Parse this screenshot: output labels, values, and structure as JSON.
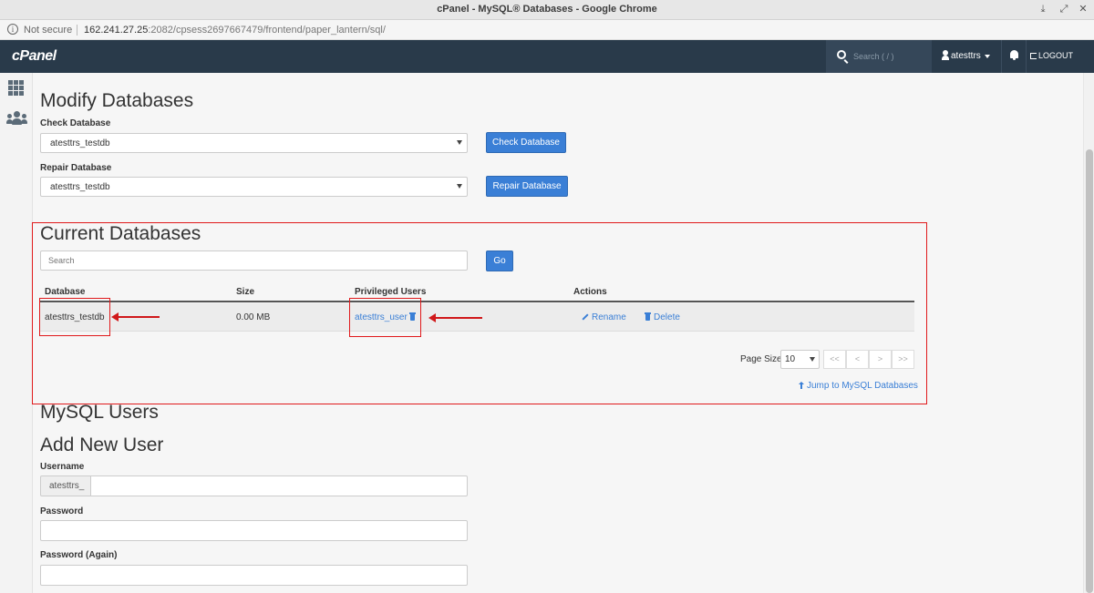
{
  "window": {
    "title": "cPanel - MySQL® Databases - Google Chrome",
    "btn_min": "⤓",
    "btn_max": "⤢",
    "btn_close": "✕"
  },
  "urlbar": {
    "security": "Not secure",
    "info_glyph": "i",
    "url_host": "162.241.27.25",
    "url_rest": ":2082/cpsess2697667479/frontend/paper_lantern/sql/"
  },
  "topnav": {
    "logo": "cPanel",
    "search_placeholder": "Search ( / )",
    "username": "atesttrs",
    "logout": "LOGOUT"
  },
  "modify": {
    "heading": "Modify Databases",
    "check_label": "Check Database",
    "check_value": "atesttrs_testdb",
    "check_button": "Check Database",
    "repair_label": "Repair Database",
    "repair_value": "atesttrs_testdb",
    "repair_button": "Repair Database"
  },
  "current": {
    "heading": "Current Databases",
    "search_placeholder": "Search",
    "go_button": "Go",
    "columns": [
      "Database",
      "Size",
      "Privileged Users",
      "Actions"
    ],
    "rows": [
      {
        "database": "atesttrs_testdb",
        "size": "0.00 MB",
        "user": "atesttrs_user",
        "rename": "Rename",
        "delete": "Delete"
      }
    ],
    "page_size_label": "Page Size",
    "page_size_value": "10",
    "pager": [
      "<<",
      "<",
      ">",
      ">>"
    ],
    "jump_link": "Jump to MySQL Databases"
  },
  "users": {
    "heading": "MySQL Users",
    "add_heading": "Add New User",
    "username_label": "Username",
    "username_prefix": "atesttrs_",
    "password_label": "Password",
    "password_again_label": "Password (Again)"
  },
  "colors": {
    "nav_bg": "#293a4a",
    "primary": "#3a7fd6",
    "annotation_red": "#e0191b"
  }
}
